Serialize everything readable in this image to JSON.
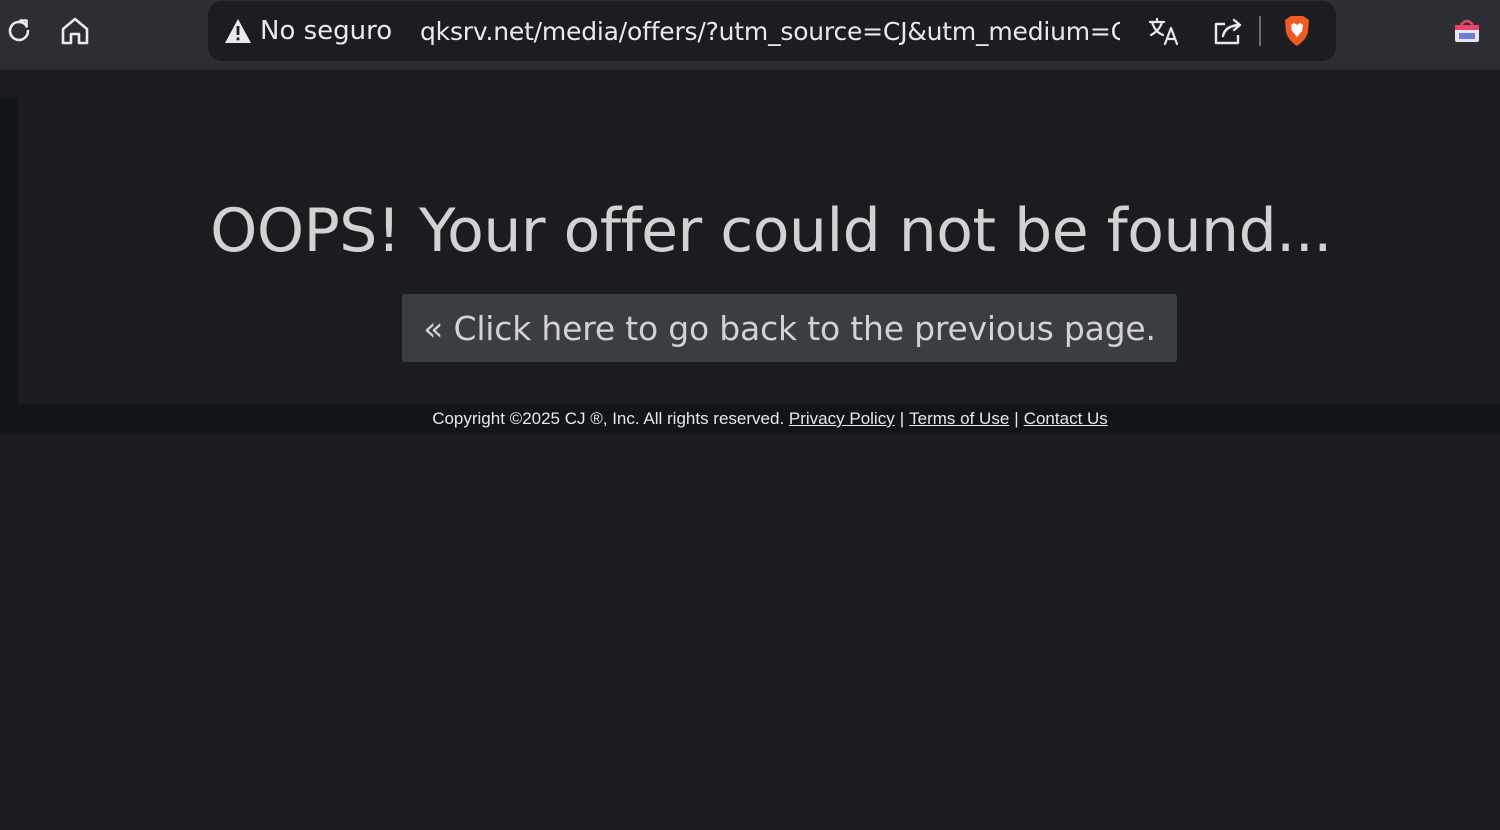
{
  "browser": {
    "security_label": "No seguro",
    "url": "qksrv.net/media/offers/?utm_source=CJ&utm_medium=C...",
    "icons": {
      "reload": "reload-icon",
      "home": "home-icon",
      "warning": "warning-icon",
      "translate": "translate-icon",
      "share": "share-icon",
      "brave": "brave-shield-icon",
      "extension": "extension-icon"
    },
    "colors": {
      "toolbar": "#2c2e33",
      "omnibox": "#1c1d20",
      "brave_orange": "#f15a24"
    }
  },
  "page": {
    "heading": "OOPS! Your offer could not be found...",
    "back_button": "« Click here to go back to the previous page.",
    "footer": {
      "copyright": "Copyright ©2025 CJ ®, Inc. All rights reserved.",
      "links": [
        "Privacy Policy",
        "Terms of Use",
        "Contact Us"
      ],
      "separator": "|"
    },
    "colors": {
      "background": "#1b1c1f",
      "button": "#3a3d41",
      "text": "#d2d2d2"
    }
  }
}
